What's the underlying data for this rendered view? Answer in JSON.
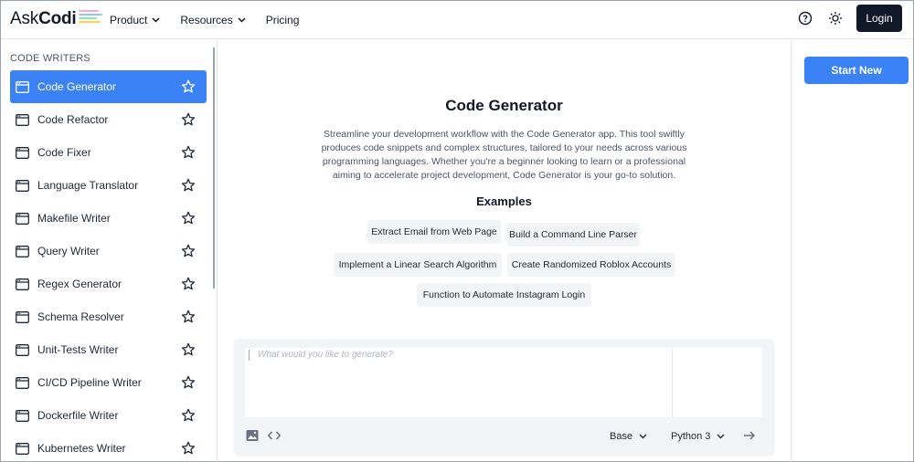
{
  "header": {
    "logo_ask": "Ask",
    "logo_codi": "Codi",
    "nav": [
      {
        "label": "Product"
      },
      {
        "label": "Resources"
      },
      {
        "label": "Pricing"
      }
    ],
    "login_label": "Login",
    "icons": [
      "help-circle-icon",
      "sun-icon"
    ]
  },
  "sidebar": {
    "heading": "CODE WRITERS",
    "items": [
      {
        "label": "Code Generator",
        "active": true
      },
      {
        "label": "Code Refactor"
      },
      {
        "label": "Code Fixer"
      },
      {
        "label": "Language Translator"
      },
      {
        "label": "Makefile Writer"
      },
      {
        "label": "Query Writer"
      },
      {
        "label": "Regex Generator"
      },
      {
        "label": "Schema Resolver"
      },
      {
        "label": "Unit-Tests Writer"
      },
      {
        "label": "CI/CD Pipeline Writer"
      },
      {
        "label": "Dockerfile Writer"
      },
      {
        "label": "Kubernetes Writer"
      }
    ]
  },
  "main": {
    "title": "Code Generator",
    "description": "Streamline your development workflow with the Code Generator app. This tool swiftly produces code snippets and complex structures, tailored to your needs across various programming languages. Whether you're a beginner looking to learn or a professional aiming to accelerate project development, Code Generator is your go-to solution.",
    "examples_title": "Examples",
    "examples": [
      "Extract Email from Web Page",
      "Build a Command Line Parser",
      "Implement a Linear Search Algorithm",
      "Create Randomized Roblox Accounts",
      "Function to Automate Instagram Login"
    ],
    "composer": {
      "placeholder": "What would you like to generate?",
      "model_select": "Base",
      "language_select": "Python 3"
    }
  },
  "rightpanel": {
    "start_label": "Start New"
  },
  "colors": {
    "accent": "#3b82f6",
    "dark": "#111827",
    "chip_bg": "#f3f4f6"
  }
}
